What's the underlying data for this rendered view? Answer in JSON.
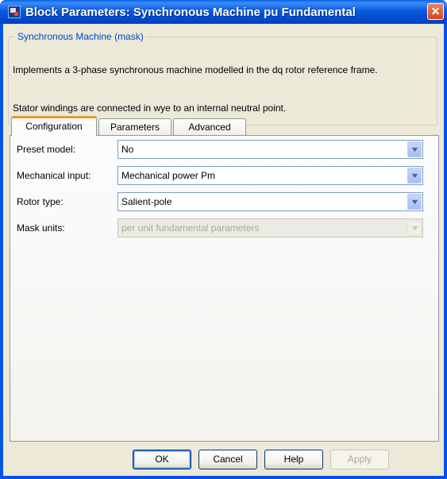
{
  "window": {
    "title": "Block Parameters: Synchronous Machine pu Fundamental",
    "close_glyph": "✕"
  },
  "group": {
    "legend": "Synchronous Machine (mask)",
    "description_line1": "Implements a 3-phase synchronous machine modelled in the dq rotor reference frame.",
    "description_line2": "Stator windings are connected in wye to an internal neutral point."
  },
  "tabs": [
    {
      "label": "Configuration",
      "active": true
    },
    {
      "label": "Parameters",
      "active": false
    },
    {
      "label": "Advanced",
      "active": false
    }
  ],
  "fields": {
    "preset_model": {
      "label": "Preset model:",
      "value": "No",
      "enabled": true
    },
    "mechanical_input": {
      "label": "Mechanical input:",
      "value": "Mechanical power Pm",
      "enabled": true
    },
    "rotor_type": {
      "label": "Rotor type:",
      "value": "Salient-pole",
      "enabled": true
    },
    "mask_units": {
      "label": "Mask units:",
      "value": "per unit fundamental parameters",
      "enabled": false
    }
  },
  "buttons": {
    "ok": "OK",
    "cancel": "Cancel",
    "help": "Help",
    "apply": "Apply"
  },
  "icons": {
    "dropdown_arrow": "▼",
    "app": "simulink-block-icon"
  },
  "colors": {
    "titlebar": "#0054e3",
    "dialog_bg": "#ece9d8",
    "legend_text": "#0046d5",
    "active_tab_accent": "#e89a2b"
  }
}
